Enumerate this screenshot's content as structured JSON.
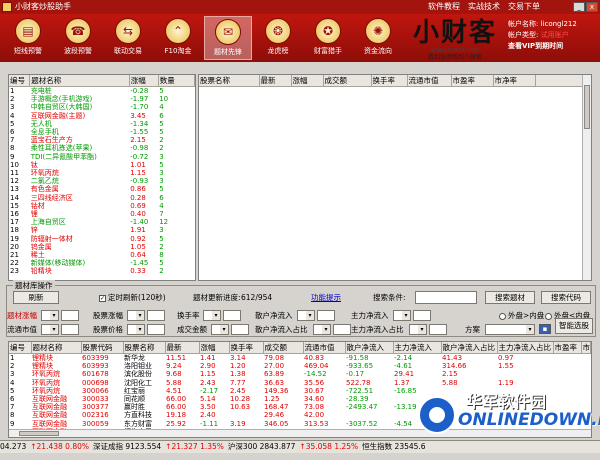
{
  "window": {
    "title": "小财客炒股助手",
    "menu": [
      "软件教程",
      "实战技术",
      "交易下单"
    ]
  },
  "nav": [
    {
      "label": "短线预警",
      "icon": "chart-icon",
      "glyph": "▤"
    },
    {
      "label": "波段预警",
      "icon": "alarm-icon",
      "glyph": "☎"
    },
    {
      "label": "联动交易",
      "icon": "link-icon",
      "glyph": "⇆"
    },
    {
      "label": "F10淘金",
      "icon": "chevron-up-icon",
      "glyph": "⌃"
    },
    {
      "label": "题材先锋",
      "icon": "mail-icon",
      "glyph": "✉"
    },
    {
      "label": "龙虎榜",
      "icon": "dragon-icon",
      "glyph": "❂"
    },
    {
      "label": "财富猎手",
      "icon": "hunter-icon",
      "glyph": "✪"
    },
    {
      "label": "资金流向",
      "icon": "globe-icon",
      "glyph": "✺"
    }
  ],
  "logo": {
    "text": "小财客",
    "url": "WWW.XCWCK.COM",
    "slogan": "看到涨停想到小财客"
  },
  "account": {
    "name_label": "帐户名称:",
    "name_value": "licongl212",
    "type_label": "帐户类型:",
    "type_value": "试用账户",
    "vip_link": "查看VIP到期时间"
  },
  "topics": {
    "headers": [
      "编号",
      "题材名称",
      "涨幅",
      "数量"
    ],
    "rows": [
      [
        "1",
        "充电桩",
        "-0.28",
        "5",
        "dn"
      ],
      [
        "2",
        "手游概念(手机游戏)",
        "-1.97",
        "10",
        "dn"
      ],
      [
        "3",
        "中韩自贸区(大韩国)",
        "-1.70",
        "4",
        "dn"
      ],
      [
        "4",
        "互联网金融(主题)",
        "3.45",
        "6",
        "up"
      ],
      [
        "5",
        "无人机",
        "-1.34",
        "5",
        "dn"
      ],
      [
        "6",
        "全息手机",
        "-1.55",
        "5",
        "dn"
      ],
      [
        "7",
        "蓝宝石生产方",
        "2.15",
        "2",
        "up"
      ],
      [
        "8",
        "柔性耳机拣选(苹果)",
        "-0.98",
        "2",
        "dn"
      ],
      [
        "9",
        "TDI(二异氰酸甲苯酯)",
        "-0.72",
        "3",
        "dn"
      ],
      [
        "10",
        "钛",
        "1.01",
        "5",
        "up"
      ],
      [
        "11",
        "环氧丙烷",
        "1.15",
        "3",
        "up"
      ],
      [
        "12",
        "二氯乙烷",
        "-0.93",
        "3",
        "dn"
      ],
      [
        "13",
        "有色金属",
        "0.86",
        "5",
        "up"
      ],
      [
        "14",
        "三四线经济区",
        "0.28",
        "6",
        "up"
      ],
      [
        "15",
        "钴材",
        "0.69",
        "4",
        "up"
      ],
      [
        "16",
        "锂",
        "0.40",
        "7",
        "up"
      ],
      [
        "17",
        "上海自贸区",
        "-1.40",
        "12",
        "dn"
      ],
      [
        "18",
        "锌",
        "1.91",
        "3",
        "up"
      ],
      [
        "19",
        "防辐射一体材",
        "0.92",
        "5",
        "up"
      ],
      [
        "20",
        "钨金属",
        "1.05",
        "2",
        "up"
      ],
      [
        "21",
        "稀土",
        "0.64",
        "8",
        "up"
      ],
      [
        "22",
        "新媒体(移动媒体)",
        "-1.45",
        "5",
        "dn"
      ],
      [
        "23",
        "铅精块",
        "0.33",
        "2",
        "up"
      ]
    ]
  },
  "stocks_top": {
    "headers": [
      "股票名称",
      "最新",
      "涨幅",
      "成交额",
      "换手率",
      "流通市值",
      "市盈率",
      "市净率"
    ]
  },
  "ops": {
    "legend": "题材库操作",
    "refresh": "刷新",
    "timer_check": "✓",
    "timer_label": "定时刷新(120秒)",
    "progress_label": "题材更新进度:",
    "progress_value": "612/954",
    "help": "功能提示",
    "search_label": "搜索条件:",
    "search_topic_btn": "搜索题材",
    "search_code_btn": "搜索代码",
    "r1": [
      "题材涨幅",
      "股票涨幅",
      "换手率",
      "散户净流入",
      "主力净流入"
    ],
    "r2": [
      "流通市值",
      "股票价格",
      "成交金额",
      "散户净流入占比",
      "主力净流入占比"
    ],
    "outer_label": "外盘>内盘",
    "inner_label": "外盘<内盘",
    "plan_label": "方案",
    "smart_btn": "智能选股"
  },
  "stocks": {
    "headers": [
      "编号",
      "题材名称",
      "股票代码",
      "股票名称",
      "最新",
      "涨幅",
      "换手率",
      "成交额",
      "流通市值",
      "散户净流入",
      "主力净流入",
      "散户净流入占比",
      "主力净流入占比",
      "市盈率",
      "市净率"
    ],
    "rows": [
      [
        "1",
        "锂精块",
        "603399",
        "新华龙",
        "11.51",
        "1.41",
        "3.14",
        "79.08",
        "40.83",
        "-91.58",
        "-2.14",
        "41.43",
        "0.97"
      ],
      [
        "2",
        "锂精块",
        "603993",
        "洛阳钼业",
        "9.24",
        "2.90",
        "1.20",
        "27.00",
        "469.04",
        "-933.65",
        "-4.61",
        "314.66",
        "1.55"
      ],
      [
        "3",
        "环氧丙烷",
        "601678",
        "滨化股份",
        "9.68",
        "1.15",
        "1.38",
        "63.89",
        "-14.52",
        "-0.17",
        "29.41",
        "2.15"
      ],
      [
        "4",
        "环氧丙烷",
        "000698",
        "沈阳化工",
        "5.88",
        "2.43",
        "7.77",
        "36.63",
        "35.56",
        "522.78",
        "1.37",
        "5.88",
        "1.19"
      ],
      [
        "5",
        "环氧丙烷",
        "300066",
        "红宝丽",
        "4.51",
        "-2.17",
        "2.45",
        "149.36",
        "30.67",
        "-722.51",
        "-16.85",
        "",
        ""
      ],
      [
        "6",
        "互联网金融",
        "300033",
        "同花顺",
        "66.00",
        "5.14",
        "10.28",
        "1.25",
        "34.60",
        "-28.39",
        "",
        "",
        ""
      ],
      [
        "7",
        "互联网金融",
        "300377",
        "赢时胜",
        "66.00",
        "3.50",
        "10.63",
        "168.47",
        "73.08",
        "-2493.47",
        "-13.19",
        "",
        ""
      ],
      [
        "8",
        "互联网金融",
        "002316",
        "方直科技",
        "19.18",
        "2.40",
        "",
        "29.46",
        "42.00",
        "",
        "",
        "",
        ""
      ],
      [
        "9",
        "互联网金融",
        "300059",
        "东方财富",
        "25.92",
        "-1.11",
        "3.19",
        "346.05",
        "313.53",
        "-3037.52",
        "-4.54",
        "",
        ""
      ],
      [
        "10",
        "互联网金融",
        "600570",
        "恒生电子",
        "",
        "",
        "",
        "",
        "",
        "",
        "",
        "",
        ""
      ],
      [
        "11",
        "互联网金融",
        "300010",
        "天成控股",
        "",
        "",
        "",
        "",
        "",
        "",
        "",
        "",
        ""
      ]
    ]
  },
  "status": [
    {
      "text": "04.273",
      "cls": ""
    },
    {
      "text": "↑21.438 0.80%",
      "cls": "red"
    },
    {
      "text": "深证成指 9123.554",
      "cls": ""
    },
    {
      "text": "↑21.327 1.35%",
      "cls": "red"
    },
    {
      "text": "沪深300 2843.877",
      "cls": ""
    },
    {
      "text": "↑35.058 1.25%",
      "cls": "red"
    },
    {
      "text": "恒生指数 23545.6",
      "cls": ""
    }
  ],
  "watermark": {
    "top": "华军软件园",
    "bottom": "ONLINEDOWN.net"
  },
  "colors": {
    "brand": "#a3140f",
    "up": "#e00000",
    "down": "#009900"
  }
}
